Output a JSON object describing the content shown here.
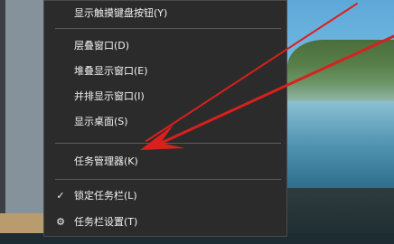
{
  "context_menu": {
    "items": [
      {
        "label": "显示触摸键盘按钮(Y)"
      },
      {
        "label": "层叠窗口(D)"
      },
      {
        "label": "堆叠显示窗口(E)"
      },
      {
        "label": "并排显示窗口(I)"
      },
      {
        "label": "显示桌面(S)"
      },
      {
        "label": "任务管理器(K)"
      },
      {
        "label": "锁定任务栏(L)",
        "prefix": "✓"
      },
      {
        "label": "任务栏设置(T)",
        "prefix": "⚙"
      }
    ]
  },
  "annotation": {
    "arrow_color": "#d8201c"
  },
  "colors": {
    "menu_background": "#2b2b2b",
    "menu_text": "#f2f2f2",
    "separator": "#5c5c5c"
  }
}
